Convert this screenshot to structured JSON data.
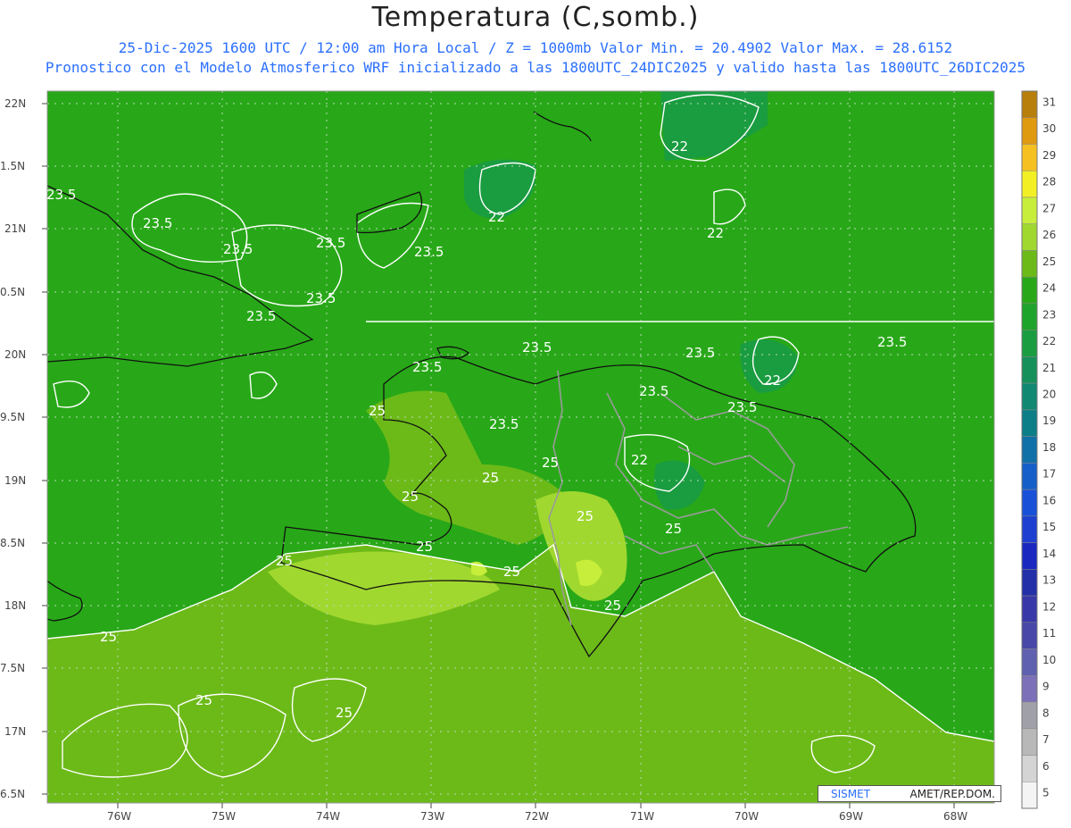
{
  "header": {
    "title": "Temperatura (C,somb.)",
    "subtitle_1": "25-Dic-2025 1600 UTC / 12:00 am Hora Local / Z = 1000mb  Valor Min. = 20.4902  Valor Max. = 28.6152",
    "subtitle_2": "Pronostico con el Modelo Atmosferico WRF inicializado a las 1800UTC_24DIC2025 y valido hasta las  1800UTC_26DIC2025"
  },
  "axes": {
    "lat_labels": [
      "22N",
      "1.5N",
      "21N",
      "0.5N",
      "20N",
      "9.5N",
      "19N",
      "8.5N",
      "18N",
      "7.5N",
      "17N",
      "6.5N"
    ],
    "lon_labels": [
      "76W",
      "75W",
      "74W",
      "73W",
      "72W",
      "71W",
      "70W",
      "69W",
      "68W"
    ]
  },
  "colorbar": {
    "levels": [
      "31",
      "30",
      "29",
      "28",
      "27",
      "26",
      "25",
      "24",
      "23",
      "22",
      "21",
      "20",
      "19",
      "18",
      "17",
      "16",
      "15",
      "14",
      "13",
      "12",
      "11",
      "10",
      "9",
      "8",
      "7",
      "6",
      "5"
    ],
    "colors": [
      "#b8800a",
      "#e09a10",
      "#f6c020",
      "#f2f024",
      "#c6ee3a",
      "#a0d830",
      "#6cba18",
      "#28a818",
      "#1ea42a",
      "#1a9c40",
      "#16905a",
      "#108872",
      "#0c7e88",
      "#1070a8",
      "#1460c8",
      "#1850d8",
      "#1e40d0",
      "#1a28c0",
      "#2430a8",
      "#3838a8",
      "#4848a8",
      "#6060b0",
      "#7c70b8",
      "#a0a0a8",
      "#b8b8b8",
      "#d4d4d4",
      "#f4f4f4"
    ]
  },
  "map_colors": {
    "land_shadow": "#6cba18",
    "sea_base": "#28a818",
    "cool_patch": "#1a9c40",
    "warm_patch": "#a0d830",
    "hot_patch": "#c6ee3a"
  },
  "contour_labels": [
    "23.5",
    "23.5",
    "23.5",
    "23.5",
    "23.5",
    "23.5",
    "23.5",
    "23.5",
    "23.5",
    "23.5",
    "23.5",
    "23.5",
    "23.5",
    "23.5",
    "22",
    "22",
    "22",
    "22",
    "22",
    "25",
    "25",
    "25",
    "25",
    "25",
    "25",
    "25",
    "25",
    "25",
    "25",
    "25",
    "25",
    "25"
  ],
  "credit": {
    "logo": "SISMET",
    "text": "AMET/REP.DOM."
  }
}
